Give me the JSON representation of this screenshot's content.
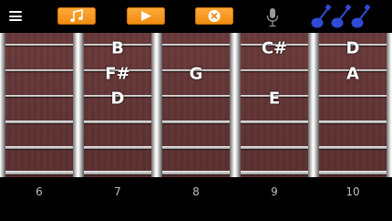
{
  "toolbar": {
    "menu_icon": "hamburger-icon",
    "buttons": [
      {
        "name": "music-note-button",
        "icon": "music-note-icon"
      },
      {
        "name": "play-button",
        "icon": "play-icon"
      },
      {
        "name": "clear-button",
        "icon": "close-circle-icon"
      }
    ],
    "mic_icon": "microphone-icon",
    "guitars_icon": "guitars-icon",
    "accent_color": "#f39a1f",
    "guitar_color": "#2f4bd6"
  },
  "fretboard": {
    "wood_color": "#633535",
    "notes": [
      {
        "label": "B"
      },
      {
        "label": "F#"
      },
      {
        "label": "D"
      },
      {
        "label": "G"
      },
      {
        "label": "C#"
      },
      {
        "label": "E"
      },
      {
        "label": "D"
      },
      {
        "label": "A"
      }
    ],
    "fret_numbers": [
      "6",
      "7",
      "8",
      "9",
      "10"
    ]
  }
}
